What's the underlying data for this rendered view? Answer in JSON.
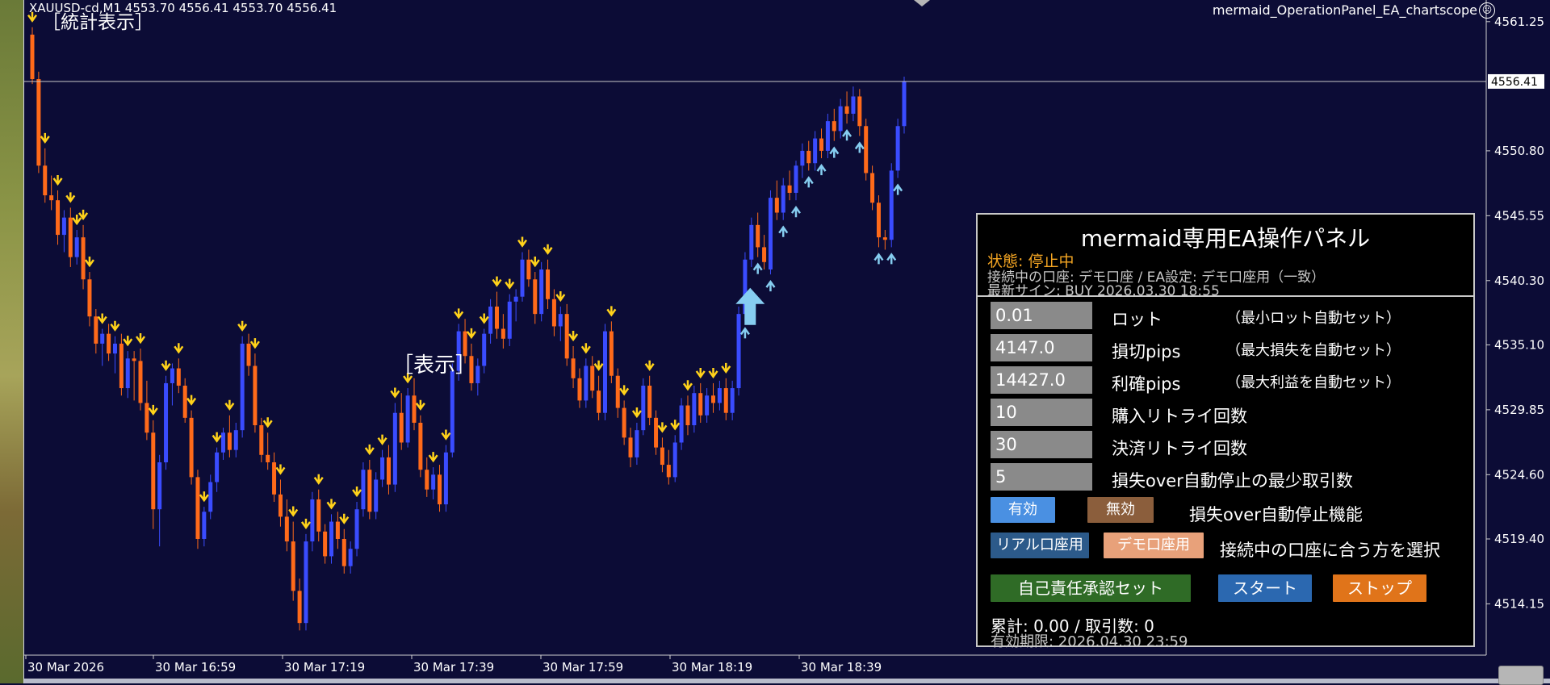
{
  "chart_data": {
    "type": "candlestick",
    "symbol_info": "XAUUSD-cd,M1  4553.70 4556.41 4553.70 4556.41",
    "ea_name": "mermaid_OperationPanel_EA_chartscope",
    "price_labels": [
      "4561.25",
      "4550.80",
      "4545.55",
      "4540.30",
      "4535.10",
      "4529.85",
      "4524.60",
      "4519.40",
      "4514.15"
    ],
    "price_ticks": [
      4561.25,
      4550.8,
      4545.55,
      4540.3,
      4535.1,
      4529.85,
      4524.6,
      4519.4,
      4514.15
    ],
    "current_price": 4556.41,
    "current_price_label": "4556.41",
    "time_labels": [
      "30 Mar 2026",
      "30 Mar 16:59",
      "30 Mar 17:19",
      "30 Mar 17:39",
      "30 Mar 17:59",
      "30 Mar 18:19",
      "30 Mar 18:39"
    ],
    "ylim": [
      4510.0,
      4563.0
    ],
    "colors": {
      "bull": "#3a4cff",
      "bear": "#ff6a1a",
      "down_arrow": "#ffd21a",
      "up_arrow": "#86cdf0",
      "axis_text": "#ffffff"
    },
    "candles": [
      [
        4560.2,
        4560.8,
        4556.2,
        4556.6
      ],
      [
        4556.6,
        4557.2,
        4549.0,
        4549.6
      ],
      [
        4549.6,
        4551.0,
        4546.6,
        4547.2
      ],
      [
        4547.2,
        4548.8,
        4546.0,
        4546.8
      ],
      [
        4546.8,
        4547.6,
        4543.2,
        4544.0
      ],
      [
        4544.0,
        4546.0,
        4542.6,
        4545.4
      ],
      [
        4545.4,
        4546.2,
        4541.4,
        4542.2
      ],
      [
        4542.2,
        4544.4,
        4541.6,
        4543.8
      ],
      [
        4543.8,
        4544.8,
        4539.6,
        4540.4
      ],
      [
        4540.4,
        4541.0,
        4536.6,
        4537.4
      ],
      [
        4537.4,
        4538.0,
        4534.4,
        4535.2
      ],
      [
        4535.2,
        4536.4,
        4533.4,
        4536.0
      ],
      [
        4536.0,
        4536.8,
        4533.8,
        4534.4
      ],
      [
        4534.4,
        4535.8,
        4532.8,
        4535.2
      ],
      [
        4535.2,
        4536.0,
        4531.0,
        4531.6
      ],
      [
        4531.6,
        4534.6,
        4530.8,
        4534.0
      ],
      [
        4534.0,
        4534.6,
        4530.6,
        4533.8
      ],
      [
        4533.8,
        4534.8,
        4529.8,
        4530.4
      ],
      [
        4530.4,
        4532.2,
        4527.4,
        4528.0
      ],
      [
        4528.0,
        4529.0,
        4520.2,
        4521.8
      ],
      [
        4521.8,
        4526.2,
        4518.8,
        4525.6
      ],
      [
        4525.6,
        4532.6,
        4525.0,
        4532.0
      ],
      [
        4532.0,
        4533.6,
        4530.2,
        4533.2
      ],
      [
        4533.2,
        4534.0,
        4531.2,
        4531.8
      ],
      [
        4531.8,
        4532.4,
        4528.8,
        4529.2
      ],
      [
        4529.2,
        4529.8,
        4523.8,
        4524.4
      ],
      [
        4524.4,
        4525.0,
        4518.6,
        4519.4
      ],
      [
        4519.4,
        4522.0,
        4518.8,
        4521.6
      ],
      [
        4521.6,
        4524.6,
        4521.0,
        4524.0
      ],
      [
        4524.0,
        4526.8,
        4523.2,
        4526.4
      ],
      [
        4526.4,
        4528.4,
        4525.8,
        4528.0
      ],
      [
        4528.0,
        4529.4,
        4526.0,
        4526.6
      ],
      [
        4526.6,
        4528.8,
        4526.0,
        4528.2
      ],
      [
        4528.2,
        4535.8,
        4527.6,
        4535.2
      ],
      [
        4535.2,
        4536.0,
        4532.6,
        4533.4
      ],
      [
        4533.4,
        4534.4,
        4528.0,
        4528.6
      ],
      [
        4528.6,
        4529.2,
        4525.6,
        4526.2
      ],
      [
        4526.2,
        4528.0,
        4525.0,
        4525.6
      ],
      [
        4525.6,
        4526.4,
        4522.4,
        4523.0
      ],
      [
        4523.0,
        4524.2,
        4520.4,
        4521.2
      ],
      [
        4521.2,
        4522.6,
        4518.4,
        4519.2
      ],
      [
        4519.2,
        4520.8,
        4514.4,
        4515.2
      ],
      [
        4515.2,
        4516.2,
        4512.0,
        4512.6
      ],
      [
        4512.6,
        4519.8,
        4512.0,
        4519.2
      ],
      [
        4519.2,
        4523.2,
        4518.4,
        4522.6
      ],
      [
        4522.6,
        4523.4,
        4519.2,
        4520.0
      ],
      [
        4520.0,
        4520.6,
        4517.4,
        4518.0
      ],
      [
        4518.0,
        4521.4,
        4517.4,
        4520.8
      ],
      [
        4520.8,
        4521.6,
        4518.6,
        4519.4
      ],
      [
        4519.4,
        4520.2,
        4516.6,
        4517.2
      ],
      [
        4517.2,
        4519.2,
        4516.6,
        4518.6
      ],
      [
        4518.6,
        4522.4,
        4518.0,
        4521.8
      ],
      [
        4521.8,
        4525.6,
        4521.2,
        4525.0
      ],
      [
        4525.0,
        4525.8,
        4521.0,
        4521.6
      ],
      [
        4521.6,
        4524.8,
        4521.0,
        4524.2
      ],
      [
        4524.2,
        4526.6,
        4523.6,
        4526.0
      ],
      [
        4526.0,
        4527.0,
        4523.0,
        4523.8
      ],
      [
        4523.8,
        4530.4,
        4523.2,
        4529.6
      ],
      [
        4529.6,
        4531.2,
        4526.6,
        4527.2
      ],
      [
        4527.2,
        4531.6,
        4526.8,
        4531.0
      ],
      [
        4531.0,
        4532.4,
        4528.2,
        4528.8
      ],
      [
        4528.8,
        4529.4,
        4524.4,
        4525.0
      ],
      [
        4525.0,
        4526.0,
        4522.8,
        4523.4
      ],
      [
        4523.4,
        4525.2,
        4522.6,
        4524.6
      ],
      [
        4524.6,
        4525.4,
        4521.6,
        4522.2
      ],
      [
        4522.2,
        4527.0,
        4521.6,
        4526.4
      ],
      [
        4526.4,
        4533.6,
        4526.0,
        4533.0
      ],
      [
        4533.0,
        4536.8,
        4532.2,
        4536.2
      ],
      [
        4536.2,
        4537.2,
        4533.6,
        4534.2
      ],
      [
        4534.2,
        4535.2,
        4531.4,
        4532.0
      ],
      [
        4532.0,
        4534.0,
        4531.0,
        4533.4
      ],
      [
        4533.4,
        4536.4,
        4532.8,
        4536.0
      ],
      [
        4536.0,
        4538.8,
        4535.2,
        4538.2
      ],
      [
        4538.2,
        4539.4,
        4535.6,
        4536.4
      ],
      [
        4536.4,
        4537.6,
        4534.8,
        4535.6
      ],
      [
        4535.6,
        4539.2,
        4535.0,
        4538.6
      ],
      [
        4538.6,
        4539.6,
        4537.0,
        4539.0
      ],
      [
        4539.0,
        4542.6,
        4538.6,
        4542.0
      ],
      [
        4542.0,
        4542.8,
        4539.8,
        4540.4
      ],
      [
        4540.4,
        4541.0,
        4536.8,
        4537.6
      ],
      [
        4537.6,
        4541.8,
        4537.0,
        4541.2
      ],
      [
        4541.2,
        4542.0,
        4538.0,
        4538.8
      ],
      [
        4538.8,
        4539.6,
        4535.8,
        4536.6
      ],
      [
        4536.6,
        4538.2,
        4535.4,
        4537.6
      ],
      [
        4537.6,
        4538.4,
        4533.4,
        4534.0
      ],
      [
        4534.0,
        4535.0,
        4531.6,
        4532.4
      ],
      [
        4532.4,
        4533.2,
        4530.0,
        4530.6
      ],
      [
        4530.6,
        4534.0,
        4530.0,
        4533.4
      ],
      [
        4533.4,
        4534.2,
        4530.8,
        4531.4
      ],
      [
        4531.4,
        4532.6,
        4529.0,
        4529.6
      ],
      [
        4529.6,
        4536.8,
        4529.0,
        4536.2
      ],
      [
        4536.2,
        4537.0,
        4532.0,
        4532.6
      ],
      [
        4532.6,
        4533.2,
        4529.2,
        4530.0
      ],
      [
        4530.0,
        4530.6,
        4527.0,
        4527.6
      ],
      [
        4527.6,
        4528.4,
        4525.2,
        4526.0
      ],
      [
        4526.0,
        4528.8,
        4525.4,
        4528.2
      ],
      [
        4528.2,
        4532.4,
        4527.8,
        4531.8
      ],
      [
        4531.8,
        4532.6,
        4528.6,
        4529.2
      ],
      [
        4529.2,
        4529.8,
        4526.2,
        4526.8
      ],
      [
        4526.8,
        4527.6,
        4524.8,
        4525.4
      ],
      [
        4525.4,
        4526.6,
        4523.8,
        4524.4
      ],
      [
        4524.4,
        4527.8,
        4524.0,
        4527.2
      ],
      [
        4527.2,
        4530.8,
        4526.6,
        4530.2
      ],
      [
        4530.2,
        4531.0,
        4527.8,
        4528.6
      ],
      [
        4528.6,
        4531.8,
        4528.0,
        4531.2
      ],
      [
        4531.2,
        4532.0,
        4528.8,
        4529.4
      ],
      [
        4529.4,
        4531.6,
        4528.8,
        4531.0
      ],
      [
        4531.0,
        4532.0,
        4529.6,
        4530.4
      ],
      [
        4530.4,
        4532.2,
        4529.8,
        4531.6
      ],
      [
        4531.6,
        4532.4,
        4529.0,
        4529.6
      ],
      [
        4529.6,
        4532.2,
        4529.0,
        4531.6
      ],
      [
        4531.6,
        4538.2,
        4531.0,
        4537.6
      ],
      [
        4537.6,
        4542.6,
        4537.0,
        4542.0
      ],
      [
        4542.0,
        4545.4,
        4541.4,
        4544.8
      ],
      [
        4544.8,
        4545.8,
        4542.2,
        4543.0
      ],
      [
        4543.0,
        4544.0,
        4541.2,
        4541.8
      ],
      [
        4541.2,
        4547.6,
        4540.8,
        4547.0
      ],
      [
        4547.0,
        4548.4,
        4545.2,
        4545.8
      ],
      [
        4545.8,
        4548.6,
        4545.2,
        4548.0
      ],
      [
        4548.0,
        4549.2,
        4546.8,
        4547.4
      ],
      [
        4547.4,
        4550.0,
        4546.8,
        4549.6
      ],
      [
        4549.6,
        4551.4,
        4548.6,
        4550.8
      ],
      [
        4550.8,
        4551.6,
        4549.2,
        4549.8
      ],
      [
        4549.8,
        4552.4,
        4549.2,
        4551.8
      ],
      [
        4551.8,
        4552.6,
        4550.2,
        4550.8
      ],
      [
        4550.8,
        4553.8,
        4550.2,
        4553.2
      ],
      [
        4553.2,
        4554.2,
        4551.6,
        4552.4
      ],
      [
        4552.4,
        4555.0,
        4551.8,
        4554.4
      ],
      [
        4554.4,
        4555.6,
        4553.0,
        4553.8
      ],
      [
        4553.8,
        4556.0,
        4553.2,
        4555.2
      ],
      [
        4555.2,
        4555.8,
        4552.0,
        4552.8
      ],
      [
        4552.8,
        4553.4,
        4548.4,
        4549.0
      ],
      [
        4549.0,
        4549.6,
        4546.0,
        4546.6
      ],
      [
        4546.6,
        4547.2,
        4543.0,
        4543.8
      ],
      [
        4543.8,
        4544.4,
        4542.8,
        4543.6
      ],
      [
        4543.6,
        4549.8,
        4543.0,
        4549.2
      ],
      [
        4549.2,
        4553.4,
        4548.6,
        4552.8
      ],
      [
        4552.8,
        4556.8,
        4552.2,
        4556.41
      ]
    ],
    "down_arrows": [
      0,
      2,
      4,
      6,
      7,
      8,
      9,
      11,
      13,
      15,
      17,
      19,
      21,
      23,
      25,
      27,
      29,
      31,
      33,
      35,
      37,
      39,
      41,
      43,
      45,
      47,
      49,
      51,
      53,
      55,
      57,
      59,
      61,
      63,
      65,
      67,
      69,
      71,
      73,
      75,
      77,
      79,
      81,
      83,
      85,
      87,
      89,
      91,
      93,
      95,
      97,
      99,
      101,
      103,
      105,
      107,
      109
    ],
    "up_arrows": [
      112,
      114,
      116,
      118,
      120,
      122,
      124,
      126,
      128,
      130,
      133,
      135,
      136
    ],
    "big_up_arrow_index": 109
  },
  "labels": {
    "stat_display": "［統計表示］",
    "display": "［表示］"
  },
  "panel": {
    "title": "mermaid専用EA操作パネル",
    "status": "状態: 停止中",
    "account": "接続中の口座: デモ口座 / EA設定: デモ口座用（一致）",
    "signal": "最新サイン: BUY 2026.03.30 18:55",
    "fields": [
      {
        "value": "0.01",
        "label": "ロット",
        "note": "（最小ロット自動セット）"
      },
      {
        "value": "4147.0",
        "label": "損切pips",
        "note": "（最大損失を自動セット）"
      },
      {
        "value": "14427.0",
        "label": "利確pips",
        "note": "（最大利益を自動セット）"
      },
      {
        "value": "10",
        "label": "購入リトライ回数",
        "note": ""
      },
      {
        "value": "30",
        "label": "決済リトライ回数",
        "note": ""
      },
      {
        "value": "5",
        "label": "損失over自動停止の最少取引数",
        "note": ""
      }
    ],
    "enable_label": "有効",
    "disable_label": "無効",
    "auto_stop_label": "損失over自動停止機能",
    "real_label": "リアル口座用",
    "demo_label": "デモ口座用",
    "account_select_label": "接続中の口座に合う方を選択",
    "confirm_label": "自己責任承認セット",
    "start_label": "スタート",
    "stop_label": "ストップ",
    "total": "累計: 0.00 / 取引数: 0",
    "expire": "有効期限: 2026.04.30 23:59",
    "colors": {
      "enable": "#4a90e2",
      "disable": "#8b5e3c",
      "real": "#2c5a8a",
      "demo": "#e8a17a",
      "confirm": "#2f6b26",
      "start": "#2b68b0",
      "stop": "#e0741a"
    }
  }
}
